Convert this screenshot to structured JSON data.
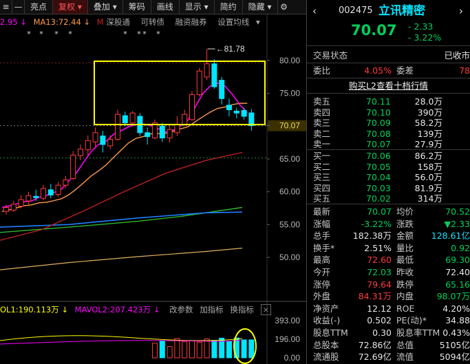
{
  "toolbar": {
    "items": [
      "亮点",
      "复权",
      "叠加",
      "筹码",
      "画线",
      "显示",
      "简约",
      "隐藏"
    ],
    "active": "复权"
  },
  "legend": {
    "ma_prefix": "2.95 ↓",
    "ma13": "MA13:72.44 ↓",
    "m": "M",
    "shen_gu_tong": "深股通",
    "convertible": "可转债",
    "margin": "融资融券",
    "set_ma": "设置均线"
  },
  "price_axis": [
    "80.00",
    "75.00",
    "70.07",
    "65.00",
    "60.00",
    "55.00",
    "50.00"
  ],
  "high_label": "81.78",
  "vol_legend": {
    "vol": "OL1:190.113万 ↓",
    "mavol2": "MAVOL2:207.423万 ↓",
    "params": "改参数",
    "add": "加指标",
    "swap": "换指标"
  },
  "vol_axis": [
    "393.00",
    "196.00",
    "0.00"
  ],
  "chart_data": {
    "type": "candlestick",
    "current_price": 70.07,
    "high_marker": 81.78,
    "price_axis_range": [
      48,
      84
    ],
    "candles": [
      {
        "o": 57.0,
        "c": 57.6,
        "h": 58.0,
        "l": 56.5
      },
      {
        "o": 57.2,
        "c": 58.1,
        "h": 58.6,
        "l": 56.9
      },
      {
        "o": 57.8,
        "c": 58.8,
        "h": 59.5,
        "l": 57.5
      },
      {
        "o": 58.6,
        "c": 59.4,
        "h": 60.0,
        "l": 58.1
      },
      {
        "o": 59.3,
        "c": 59.1,
        "h": 60.3,
        "l": 58.6
      },
      {
        "o": 59.0,
        "c": 60.5,
        "h": 61.0,
        "l": 58.7
      },
      {
        "o": 60.3,
        "c": 59.5,
        "h": 61.2,
        "l": 59.0
      },
      {
        "o": 59.6,
        "c": 61.0,
        "h": 61.5,
        "l": 59.2
      },
      {
        "o": 61.0,
        "c": 61.8,
        "h": 62.4,
        "l": 60.6
      },
      {
        "o": 62.0,
        "c": 65.6,
        "h": 66.2,
        "l": 61.8
      },
      {
        "o": 65.5,
        "c": 66.5,
        "h": 67.2,
        "l": 64.8
      },
      {
        "o": 66.4,
        "c": 67.8,
        "h": 68.6,
        "l": 65.5
      },
      {
        "o": 67.6,
        "c": 69.0,
        "h": 69.8,
        "l": 66.8
      },
      {
        "o": 68.5,
        "c": 67.2,
        "h": 69.3,
        "l": 66.0
      },
      {
        "o": 67.0,
        "c": 68.0,
        "h": 68.6,
        "l": 66.5
      },
      {
        "o": 68.0,
        "c": 71.8,
        "h": 72.5,
        "l": 67.8
      },
      {
        "o": 71.6,
        "c": 70.5,
        "h": 72.2,
        "l": 70.0
      },
      {
        "o": 70.5,
        "c": 72.0,
        "h": 72.3,
        "l": 70.0
      },
      {
        "o": 71.5,
        "c": 69.0,
        "h": 72.0,
        "l": 68.5
      },
      {
        "o": 69.0,
        "c": 68.4,
        "h": 69.8,
        "l": 67.2
      },
      {
        "o": 68.2,
        "c": 70.5,
        "h": 71.0,
        "l": 68.0
      },
      {
        "o": 70.0,
        "c": 68.2,
        "h": 70.5,
        "l": 67.6
      },
      {
        "o": 68.2,
        "c": 69.5,
        "h": 70.2,
        "l": 67.5
      },
      {
        "o": 69.0,
        "c": 70.2,
        "h": 71.5,
        "l": 68.5
      },
      {
        "o": 70.3,
        "c": 71.8,
        "h": 72.5,
        "l": 70.0
      },
      {
        "o": 71.0,
        "c": 74.8,
        "h": 75.3,
        "l": 70.8
      },
      {
        "o": 74.8,
        "c": 78.4,
        "h": 78.9,
        "l": 74.5
      },
      {
        "o": 77.5,
        "c": 79.5,
        "h": 81.78,
        "l": 77.0
      },
      {
        "o": 79.5,
        "c": 76.0,
        "h": 80.2,
        "l": 75.7
      },
      {
        "o": 77.0,
        "c": 74.2,
        "h": 77.5,
        "l": 73.3
      },
      {
        "o": 73.2,
        "c": 72.5,
        "h": 74.2,
        "l": 71.5
      },
      {
        "o": 72.3,
        "c": 72.0,
        "h": 72.8,
        "l": 71.2
      },
      {
        "o": 72.4,
        "c": 71.5,
        "h": 72.8,
        "l": 71.0
      },
      {
        "o": 72.03,
        "c": 70.07,
        "h": 72.6,
        "l": 69.3
      }
    ],
    "volumes": [
      155,
      180,
      120,
      205,
      170,
      178,
      165,
      200,
      185,
      208,
      175,
      210,
      190,
      190
    ],
    "vol_axis_range": [
      0,
      393
    ]
  },
  "quote": {
    "code": "002475",
    "name": "立讯精密",
    "price": "70.07",
    "change": "- 2.33",
    "pct": "- 3.22%",
    "status_label": "交易状态",
    "status": "已收市",
    "wb_label": "委比",
    "wb": "4.05%",
    "wc_label": "委差",
    "wc": "78",
    "l2_link": "购买L2查看十档行情",
    "asks": [
      {
        "label": "卖五",
        "price": "70.11",
        "vol": "28.0万"
      },
      {
        "label": "卖四",
        "price": "70.10",
        "vol": "390万"
      },
      {
        "label": "卖三",
        "price": "70.09",
        "vol": "58.2万"
      },
      {
        "label": "卖二",
        "price": "70.08",
        "vol": "139万"
      },
      {
        "label": "卖一",
        "price": "70.07",
        "vol": "27.9万"
      }
    ],
    "bids": [
      {
        "label": "买一",
        "price": "70.06",
        "vol": "86.2万"
      },
      {
        "label": "买二",
        "price": "70.05",
        "vol": "158万"
      },
      {
        "label": "买三",
        "price": "70.04",
        "vol": "56.0万"
      },
      {
        "label": "买四",
        "price": "70.03",
        "vol": "81.9万"
      },
      {
        "label": "买五",
        "price": "70.02",
        "vol": "314万"
      }
    ],
    "stats": [
      {
        "l1": "最新",
        "v1": "70.07",
        "c1": "dn",
        "l2": "均价",
        "v2": "70.52",
        "c2": "dn"
      },
      {
        "l1": "涨幅",
        "v1": "-3.22%",
        "c1": "dn",
        "l2": "涨跌",
        "v2": "▼2.33",
        "c2": "dn"
      },
      {
        "l1": "总手",
        "v1": "182.38万",
        "c1": "wh",
        "l2": "金额",
        "v2": "128.61亿",
        "c2": "cy"
      },
      {
        "l1": "换手*",
        "v1": "2.51%",
        "c1": "wh",
        "l2": "量比",
        "v2": "0.92",
        "c2": "dn"
      },
      {
        "l1": "最高",
        "v1": "72.60",
        "c1": "up",
        "l2": "最低",
        "v2": "69.30",
        "c2": "dn"
      },
      {
        "l1": "今开",
        "v1": "72.03",
        "c1": "dn",
        "l2": "昨收",
        "v2": "72.40",
        "c2": "wh"
      },
      {
        "l1": "涨停",
        "v1": "79.64",
        "c1": "up",
        "l2": "跌停",
        "v2": "65.16",
        "c2": "dn"
      },
      {
        "l1": "外盘",
        "v1": "84.31万",
        "c1": "up",
        "l2": "内盘",
        "v2": "98.07万",
        "c2": "dn"
      },
      {
        "l1": "净资产",
        "v1": "12.12",
        "c1": "wh",
        "l2": "ROE",
        "v2": "4.20%",
        "c2": "wh"
      },
      {
        "l1": "收益(-)",
        "v1": "0.502",
        "c1": "wh",
        "l2": "PE(动)*",
        "v2": "34.88",
        "c2": "wh"
      },
      {
        "l1": "股息TTM",
        "v1": "0.30",
        "c1": "wh",
        "l2": "股息率TTM",
        "v2": "0.43%",
        "c2": "wh"
      },
      {
        "l1": "总股本",
        "v1": "72.86亿",
        "c1": "wh",
        "l2": "总值",
        "v2": "5105亿",
        "c2": "wh"
      },
      {
        "l1": "流通股",
        "v1": "72.69亿",
        "c1": "wh",
        "l2": "流值",
        "v2": "5094亿",
        "c2": "wh"
      }
    ]
  },
  "colors": {
    "up": "#ff3b3b",
    "down": "#00e6ff",
    "highlight": "#ffff00",
    "ma5": "#ff00ff",
    "ma10": "#ff9a4a",
    "ma20": "#c02020",
    "ma30": "#1e7fff",
    "ma60": "#2db82d",
    "ma120": "#e0b060"
  }
}
